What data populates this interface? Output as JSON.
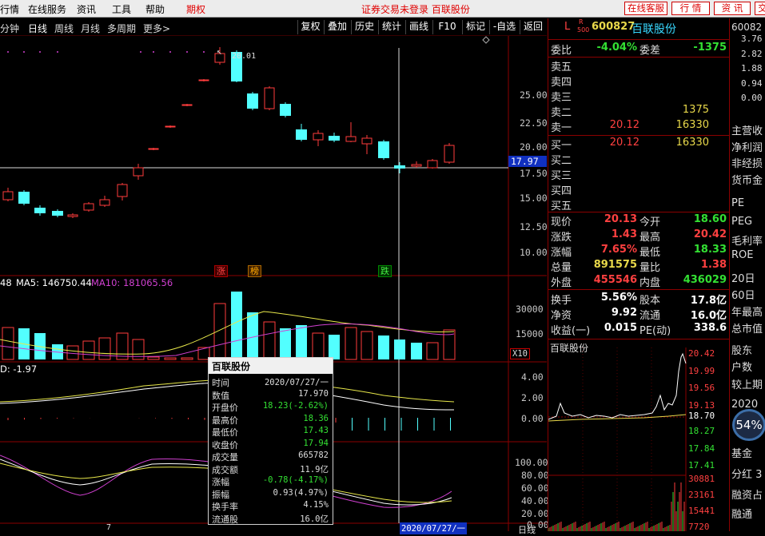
{
  "menubar": {
    "items": [
      "行情",
      "在线服务",
      "资讯",
      "工具",
      "帮助",
      "期权"
    ],
    "status": "证券交易未登录 百联股份",
    "buttons": [
      "在线客服",
      "行 情",
      "资 讯",
      "交"
    ]
  },
  "toolbar": {
    "periods": [
      "分钟",
      "日线",
      "周线",
      "月线",
      "多周期",
      "更多>"
    ],
    "active": "日线",
    "tools": [
      "复权",
      "叠加",
      "历史",
      "统计",
      "画线",
      "F10",
      "标记",
      "-自选",
      "返回"
    ]
  },
  "chart": {
    "price_ticks": [
      "25.00",
      "22.50",
      "20.00",
      "17.50",
      "15.00",
      "12.50",
      "10.00"
    ],
    "cursor_price": "17.97",
    "high_marker": "20.01",
    "badges": [
      "涨",
      "榜",
      "跌"
    ],
    "volume_legend": {
      "vol": "48",
      "ma5": "MA5: 146750.44",
      "ma10": "MA10: 181065.56"
    },
    "volume_ticks": [
      "30000",
      "15000"
    ],
    "volume_unit": "X10",
    "macd_legend": "D: -1.97",
    "macd_ticks": [
      "4.00",
      "2.00",
      "0.00"
    ],
    "kdj_ticks": [
      "100.00",
      "80.00",
      "60.00",
      "40.00",
      "20.00",
      "0.00"
    ],
    "date_label": "2020/07/27/一",
    "period_label": "日线",
    "x_mark": "7"
  },
  "tooltip": {
    "title": "百联股份",
    "rows": [
      {
        "k": "时间",
        "v": "2020/07/27/一",
        "c": "#ddd"
      },
      {
        "k": "数值",
        "v": "17.970",
        "c": "#ddd"
      },
      {
        "k": "开盘价",
        "v": "18.23(-2.62%)",
        "c": "#33e033"
      },
      {
        "k": "最高价",
        "v": "18.36",
        "c": "#33e033"
      },
      {
        "k": "最低价",
        "v": "17.43",
        "c": "#33e033"
      },
      {
        "k": "收盘价",
        "v": "17.94",
        "c": "#33e033"
      },
      {
        "k": "成交量",
        "v": "665782",
        "c": "#ddd"
      },
      {
        "k": "成交额",
        "v": "11.9亿",
        "c": "#ddd"
      },
      {
        "k": "涨幅",
        "v": "-0.78(-4.17%)",
        "c": "#33e033"
      },
      {
        "k": "振幅",
        "v": "0.93(4.97%)",
        "c": "#ddd"
      },
      {
        "k": "换手率",
        "v": "4.15%",
        "c": "#ddd"
      },
      {
        "k": "流通股",
        "v": "16.0亿",
        "c": "#ddd"
      }
    ]
  },
  "quote": {
    "header": {
      "prefix": "L",
      "badge_top": "R",
      "badge_bottom": "500",
      "code": "600827",
      "name": "百联股份"
    },
    "weibi": {
      "label": "委比",
      "value": "-4.04%",
      "label2": "委差",
      "value2": "-1375"
    },
    "sell": [
      {
        "label": "卖五",
        "price": "",
        "vol": ""
      },
      {
        "label": "卖四",
        "price": "",
        "vol": ""
      },
      {
        "label": "卖三",
        "price": "",
        "vol": ""
      },
      {
        "label": "卖二",
        "price": "",
        "vol": "1375"
      },
      {
        "label": "卖一",
        "price": "20.12",
        "vol": "16330"
      }
    ],
    "buy": [
      {
        "label": "买一",
        "price": "20.12",
        "vol": "16330"
      },
      {
        "label": "买二",
        "price": "",
        "vol": ""
      },
      {
        "label": "买三",
        "price": "",
        "vol": ""
      },
      {
        "label": "买四",
        "price": "",
        "vol": ""
      },
      {
        "label": "买五",
        "price": "",
        "vol": ""
      }
    ],
    "stats": [
      {
        "l1": "现价",
        "v1": "20.13",
        "c1": "red",
        "l2": "今开",
        "v2": "18.60",
        "c2": "green"
      },
      {
        "l1": "涨跌",
        "v1": "1.43",
        "c1": "red",
        "l2": "最高",
        "v2": "20.42",
        "c2": "red"
      },
      {
        "l1": "涨幅",
        "v1": "7.65%",
        "c1": "red",
        "l2": "最低",
        "v2": "18.33",
        "c2": "green"
      },
      {
        "l1": "总量",
        "v1": "891575",
        "c1": "yellow",
        "l2": "量比",
        "v2": "1.38",
        "c2": "red"
      },
      {
        "l1": "外盘",
        "v1": "455546",
        "c1": "red",
        "l2": "内盘",
        "v2": "436029",
        "c2": "green"
      }
    ],
    "stats2": [
      {
        "l1": "换手",
        "v1": "5.56%",
        "c1": "white",
        "l2": "股本",
        "v2": "17.8亿",
        "c2": "white"
      },
      {
        "l1": "净资",
        "v1": "9.92",
        "c1": "white",
        "l2": "流通",
        "v2": "16.0亿",
        "c2": "white"
      },
      {
        "l1": "收益(一)",
        "v1": "0.015",
        "c1": "white",
        "l2": "PE(动)",
        "v2": "338.6",
        "c2": "white"
      }
    ],
    "mini_title": "百联股份",
    "mini_ticks_red": [
      "20.42",
      "19.99",
      "19.56",
      "19.13"
    ],
    "mini_mid": "18.70",
    "mini_ticks_green": [
      "18.27",
      "17.84",
      "17.41"
    ],
    "mini_vol_ticks": [
      "30881",
      "23161",
      "15441",
      "7720"
    ]
  },
  "farright": {
    "code": "60082",
    "ticks": [
      "3.76",
      "2.82",
      "1.88",
      "0.94",
      "0.00"
    ],
    "labels": [
      "主营收",
      "净利润",
      "非经损",
      "货币金",
      "PE",
      "PEG",
      "毛利率",
      "ROE",
      "20日",
      "60日",
      "年最高",
      "总市值",
      "股东",
      "户数",
      "较上期",
      "2020",
      "基金",
      "分红 3",
      "融资占",
      "融通"
    ],
    "percent": "54%"
  }
}
